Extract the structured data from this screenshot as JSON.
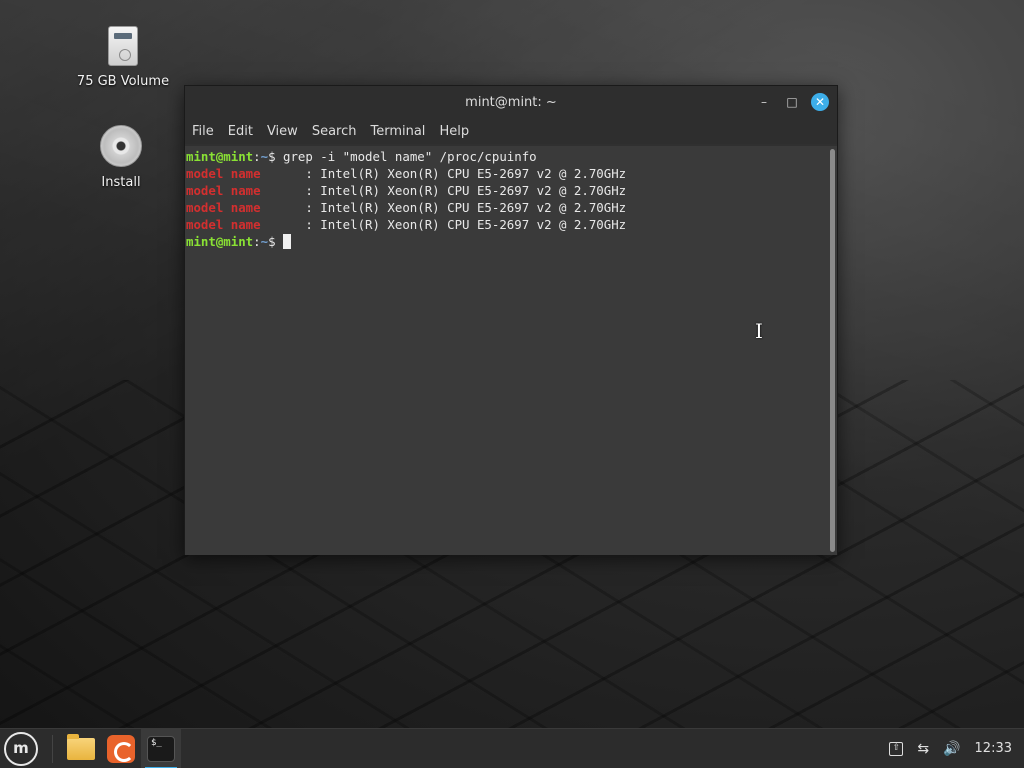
{
  "desktop": {
    "icons": [
      {
        "label": "75 GB Volume",
        "icon": "drive-icon"
      },
      {
        "label": "Install",
        "icon": "disc-icon"
      }
    ]
  },
  "window": {
    "title": "mint@mint: ~",
    "menu": [
      "File",
      "Edit",
      "View",
      "Search",
      "Terminal",
      "Help"
    ]
  },
  "terminal": {
    "prompt_user": "mint@mint",
    "prompt_path": "~",
    "command": "grep -i \"model name\" /proc/cpuinfo",
    "match_text": "model name",
    "output_value": "      : Intel(R) Xeon(R) CPU E5-2697 v2 @ 2.70GHz",
    "output_count": 4
  },
  "taskbar": {
    "clock": "12:33",
    "apps": [
      "files-icon",
      "firefox-icon",
      "terminal-icon"
    ]
  },
  "colors": {
    "accent": "#3daee9",
    "prompt": "#8ae234",
    "path": "#729fcf",
    "match": "#d32f2f"
  }
}
